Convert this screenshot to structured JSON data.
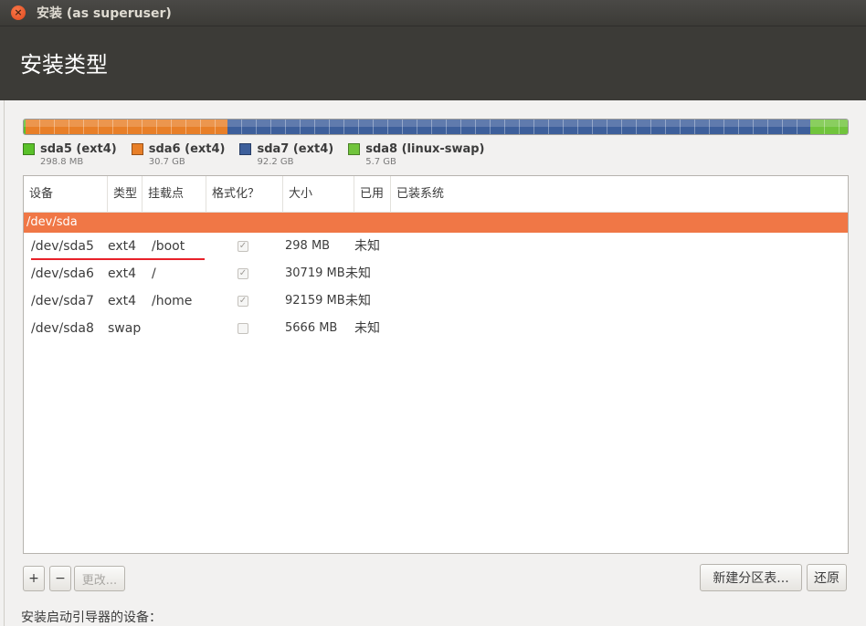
{
  "window": {
    "title": "安装 (as superuser)",
    "close_glyph": "×"
  },
  "header": {
    "title": "安装类型"
  },
  "partitions_bar": [
    {
      "name": "sda5 (ext4)",
      "size": "298.8 MB",
      "color": "#5ac12a",
      "fraction": 0.0024
    },
    {
      "name": "sda6 (ext4)",
      "size": "30.7 GB",
      "color": "#e87f28",
      "fraction": 0.2452
    },
    {
      "name": "sda7 (ext4)",
      "size": "92.2 GB",
      "color": "#3d5f9b",
      "fraction": 0.7071
    },
    {
      "name": "sda8 (linux-swap)",
      "size": "5.7 GB",
      "color": "#71c43c",
      "fraction": 0.0453
    }
  ],
  "table": {
    "columns": [
      "设备",
      "类型",
      "挂载点",
      "格式化？",
      "大小",
      "已用",
      "已装系统"
    ],
    "disk": "/dev/sda",
    "rows": [
      {
        "device": "/dev/sda5",
        "type": "ext4",
        "mount": "/boot",
        "format": true,
        "size": "298 MB",
        "used": "未知",
        "system": ""
      },
      {
        "device": "/dev/sda6",
        "type": "ext4",
        "mount": "/",
        "format": true,
        "size": "30719 MB",
        "used": "未知",
        "system": ""
      },
      {
        "device": "/dev/sda7",
        "type": "ext4",
        "mount": "/home",
        "format": true,
        "size": "92159 MB",
        "used": "未知",
        "system": ""
      },
      {
        "device": "/dev/sda8",
        "type": "swap",
        "mount": "",
        "format": false,
        "size": "5666 MB",
        "used": "未知",
        "system": ""
      }
    ]
  },
  "toolbar": {
    "add_label": "+",
    "remove_label": "−",
    "change_label": "更改...",
    "new_table_label": "新建分区表...",
    "revert_label": "还原"
  },
  "bootloader": {
    "label": "安装启动引导器的设备："
  },
  "colors": {
    "selection": "#f07746",
    "header_bg": "#3c3b37"
  }
}
